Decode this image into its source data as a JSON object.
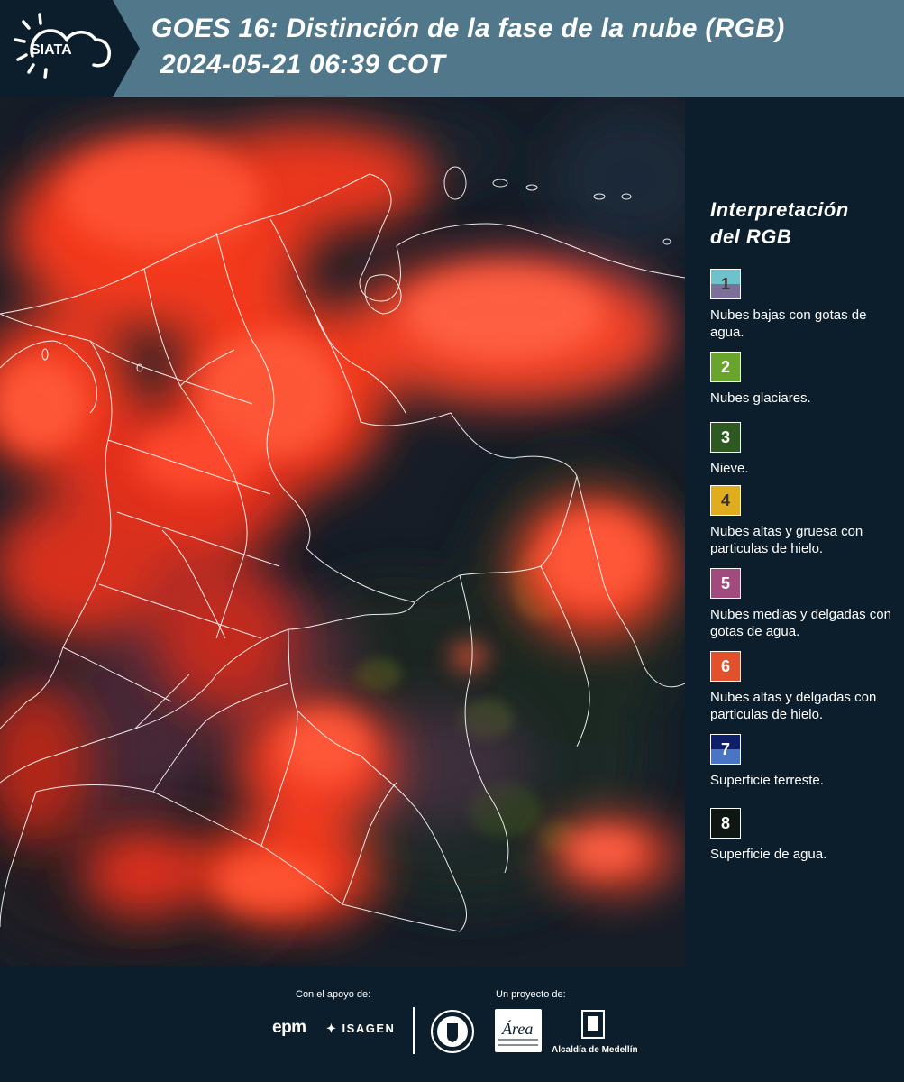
{
  "header": {
    "logo_text": "SIATA",
    "title_line1": "GOES 16: Distinción de la fase de la nube (RGB)",
    "title_line2": "2024-05-21 06:39 COT"
  },
  "legend": {
    "title_line1": "Interpretación",
    "title_line2": "del RGB",
    "items": [
      {
        "num": "1",
        "label": "Nubes bajas con gotas de agua.",
        "color_top": "#6fc2cc",
        "color_bottom": "#7b7198",
        "num_color": "#333333"
      },
      {
        "num": "2",
        "label": "Nubes glaciares.",
        "color_top": "#69a52d",
        "color_bottom": "#69a52d",
        "num_color": "#ffffff"
      },
      {
        "num": "3",
        "label": "Nieve.",
        "color_top": "#2d5a1e",
        "color_bottom": "#2d5a1e",
        "num_color": "#ffffff"
      },
      {
        "num": "4",
        "label": "Nubes altas y gruesa con particulas de hielo.",
        "color_top": "#e0ad1e",
        "color_bottom": "#e0ad1e",
        "num_color": "#333333"
      },
      {
        "num": "5",
        "label": "Nubes medias y delgadas con gotas de agua.",
        "color_top": "#a24a7d",
        "color_bottom": "#a24a7d",
        "num_color": "#ffffff"
      },
      {
        "num": "6",
        "label": "Nubes altas y delgadas con particulas de hielo.",
        "color_top": "#e2512c",
        "color_bottom": "#e2512c",
        "num_color": "#ffffff"
      },
      {
        "num": "7",
        "label": "Superficie terreste.",
        "color_top": "#0d1f6a",
        "color_bottom": "#4a74c4",
        "num_color": "#ffffff"
      },
      {
        "num": "8",
        "label": "Superficie de agua.",
        "color_top": "#0e1712",
        "color_bottom": "#0e1712",
        "num_color": "#ffffff"
      }
    ]
  },
  "footer": {
    "support_label": "Con el apoyo de:",
    "project_label": "Un proyecto de:",
    "epm": "epm",
    "isagen": "ISAGEN",
    "amva_text": "Área",
    "alcaldia": "Alcaldía de Medellín"
  },
  "colors": {
    "header_band": "#51788a",
    "background": "#0c1e2b",
    "cloud_red": "#ff3b1e"
  }
}
